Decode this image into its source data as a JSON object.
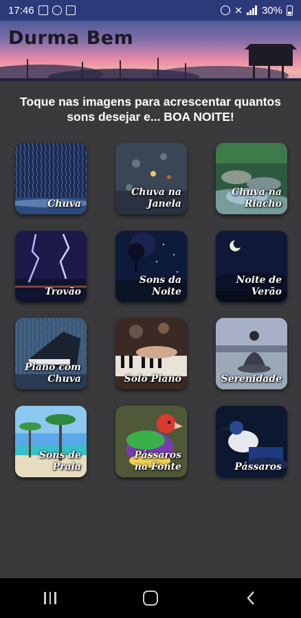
{
  "status_bar": {
    "time": "17:46",
    "battery": "30%",
    "left_icons": [
      "gallery-icon",
      "do-not-disturb-icon",
      "app-notification-icon"
    ],
    "right_icons": [
      "alarm-icon",
      "mute-icon",
      "signal-icon",
      "battery-icon"
    ]
  },
  "header": {
    "title": "Durma Bem"
  },
  "instruction": "Toque nas imagens para acrescentar quantos sons desejar e... BOA NOITE!",
  "sounds": [
    {
      "label": "Chuva",
      "art": "rain"
    },
    {
      "label": "Chuva na Janela",
      "art": "window-rain"
    },
    {
      "label": "Chuva na Riacho",
      "art": "stream"
    },
    {
      "label": "Trovão",
      "art": "thunder"
    },
    {
      "label": "Sons da Noite",
      "art": "night"
    },
    {
      "label": "Noite de Verão",
      "art": "summer-night"
    },
    {
      "label": "Piano com Chuva",
      "art": "piano-rain"
    },
    {
      "label": "Solo Piano",
      "art": "solo-piano"
    },
    {
      "label": "Serenidade",
      "art": "serenity"
    },
    {
      "label": "Sons de Praia",
      "art": "beach"
    },
    {
      "label": "Pássaros na Fonte",
      "art": "finch"
    },
    {
      "label": "Pássaros",
      "art": "kingfisher"
    }
  ],
  "nav_bar": {
    "buttons": [
      "recent-apps",
      "home",
      "back"
    ]
  }
}
